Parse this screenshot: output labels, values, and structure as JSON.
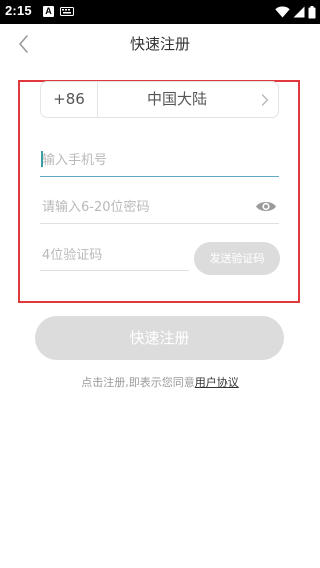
{
  "status_bar": {
    "time": "2:15",
    "notification_letter": "A"
  },
  "header": {
    "title": "快速注册",
    "back_icon": "chevron-left-icon"
  },
  "form": {
    "country_code": "+86",
    "country_name": "中国大陆",
    "phone_placeholder": "输入手机号",
    "password_placeholder": "请输入6-20位密码",
    "code_placeholder": "4位验证码",
    "send_code_label": "发送验证码",
    "show_password_icon": "eye-icon"
  },
  "register_label": "快速注册",
  "agreement": {
    "prefix": "点击注册,即表示您同意",
    "link": "用户协议"
  },
  "colors": {
    "highlight": "#e0393d",
    "disabled_button": "#dcdcdc",
    "active_underline": "#63a7c4"
  }
}
